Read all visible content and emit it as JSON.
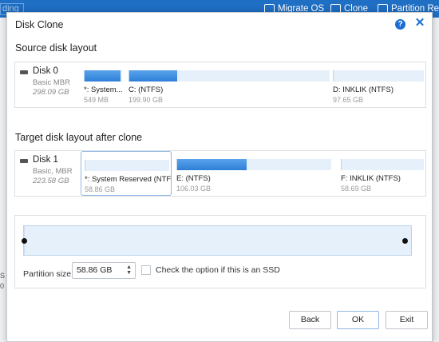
{
  "app_toolbar": {
    "search_fragment": "ding",
    "items": [
      "Migrate OS",
      "Clone",
      "Partition Reco"
    ]
  },
  "background_fragments": [
    "S",
    "0"
  ],
  "dialog": {
    "title": "Disk Clone",
    "help_glyph": "?",
    "close_glyph": "✕"
  },
  "source": {
    "section_title": "Source disk layout",
    "disk": {
      "name": "Disk 0",
      "type": "Basic MBR",
      "size": "298.09 GB"
    },
    "partitions": [
      {
        "label": "*: System...",
        "size": "549 MB",
        "used": 0.95
      },
      {
        "label": "C:  (NTFS)",
        "size": "199.90 GB",
        "used": 0.24
      },
      {
        "label": "D: INKLIK (NTFS)",
        "size": "97.65 GB",
        "used": 0.0
      }
    ]
  },
  "target": {
    "section_title": "Target disk layout after clone",
    "disk": {
      "name": "Disk 1",
      "type": "Basic, MBR",
      "size": "223.58 GB"
    },
    "partitions": [
      {
        "label": "*: System Reserved (NTF...",
        "size": "58.86 GB",
        "used": 0.0
      },
      {
        "label": "E:  (NTFS)",
        "size": "106.03 GB",
        "used": 0.45
      },
      {
        "label": "F: INKLIK (NTFS)",
        "size": "58.69 GB",
        "used": 0.0
      }
    ]
  },
  "resize": {
    "fill_fraction": 0.003,
    "partition_size_label": "Partition size:",
    "partition_size_value": "58.86 GB",
    "spinner_glyph": "▲\n▼",
    "ssd_label": "Check the option if this is an SSD",
    "ssd_checked": false
  },
  "buttons": {
    "back": "Back",
    "ok": "OK",
    "exit": "Exit"
  },
  "colors": {
    "accent": "#1a6fd4",
    "toolbar": "#1f6fc5",
    "bar_fill": "#2d7fd6",
    "bar_bg": "#e6f0fa"
  }
}
